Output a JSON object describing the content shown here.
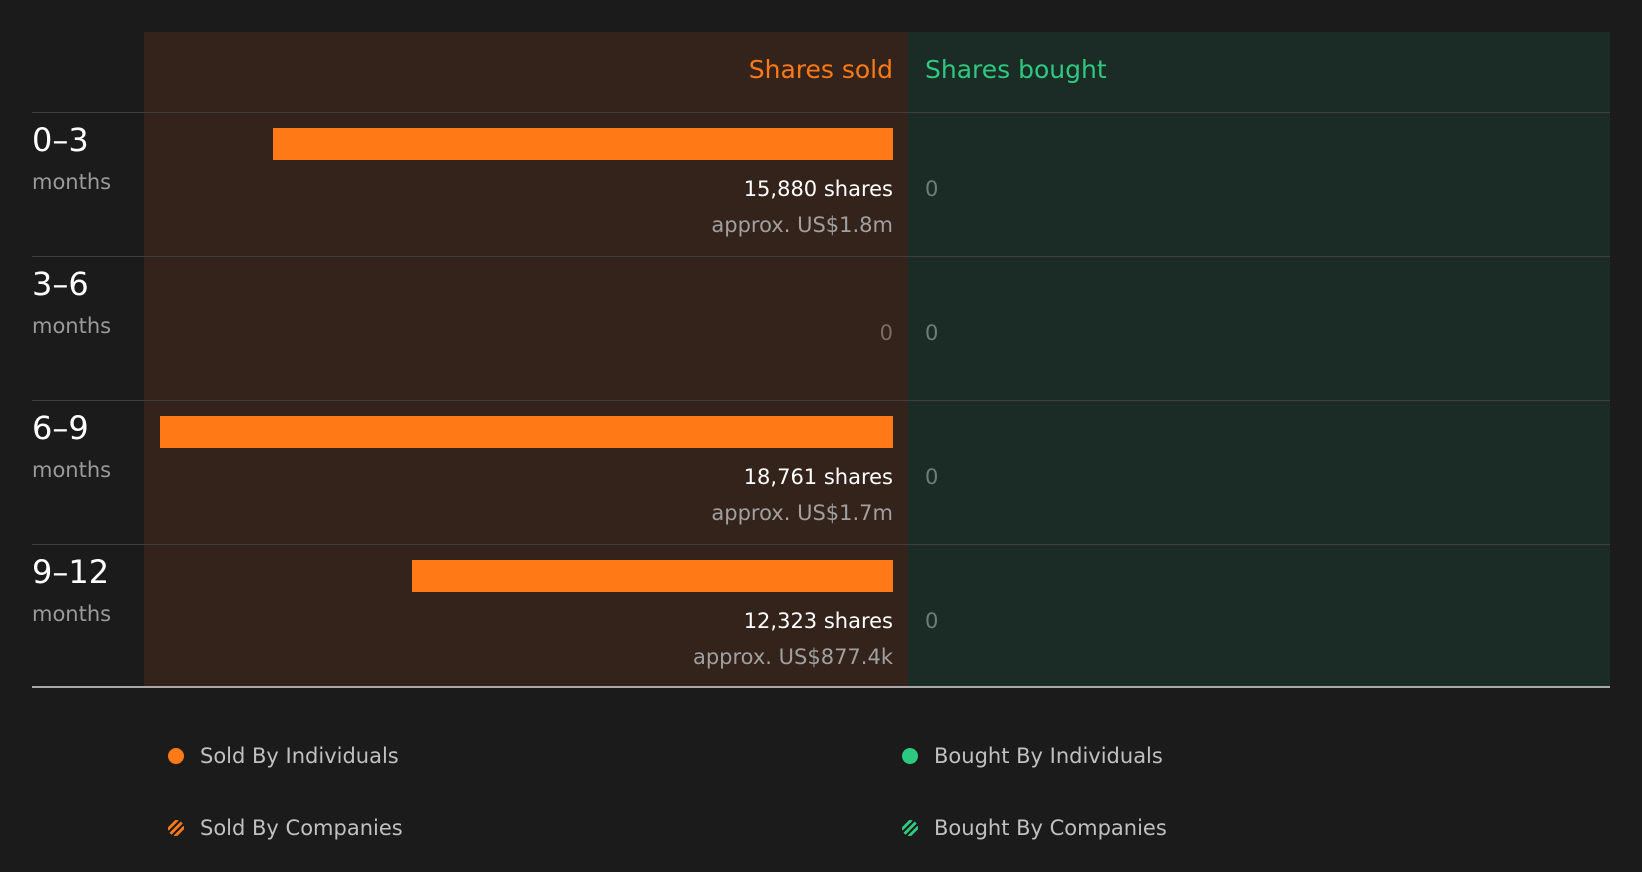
{
  "colors": {
    "sold": "#ff7916",
    "bought": "#2dc97e",
    "sold_bg": "#33231b",
    "bought_bg": "#1b2b25"
  },
  "headers": {
    "sold": "Shares sold",
    "bought": "Shares bought"
  },
  "chart_data": {
    "type": "bar",
    "orientation": "horizontal",
    "categories": [
      "0–3",
      "3–6",
      "6–9",
      "9–12"
    ],
    "category_sublabel": "months",
    "series": [
      {
        "name": "Shares sold",
        "values": [
          15880,
          0,
          18761,
          12323
        ]
      },
      {
        "name": "Shares bought",
        "values": [
          0,
          0,
          0,
          0
        ]
      }
    ],
    "data_labels": {
      "sold": [
        "15,880 shares",
        "0",
        "18,761 shares",
        "12,323 shares"
      ],
      "sold_value": [
        "approx. US$1.8m",
        "",
        "approx. US$1.7m",
        "approx. US$877.4k"
      ],
      "bought": [
        "0",
        "0",
        "0",
        "0"
      ]
    },
    "xlim": [
      0,
      18761
    ],
    "legend": {
      "placement": "bottom",
      "items": [
        {
          "label": "Sold By Individuals",
          "marker": "dot",
          "color": "#ff7916"
        },
        {
          "label": "Bought By Individuals",
          "marker": "dot",
          "color": "#2dc97e"
        },
        {
          "label": "Sold By Companies",
          "marker": "hatched",
          "color": "#ff7916"
        },
        {
          "label": "Bought By Companies",
          "marker": "hatched",
          "color": "#2dc97e"
        }
      ]
    }
  }
}
